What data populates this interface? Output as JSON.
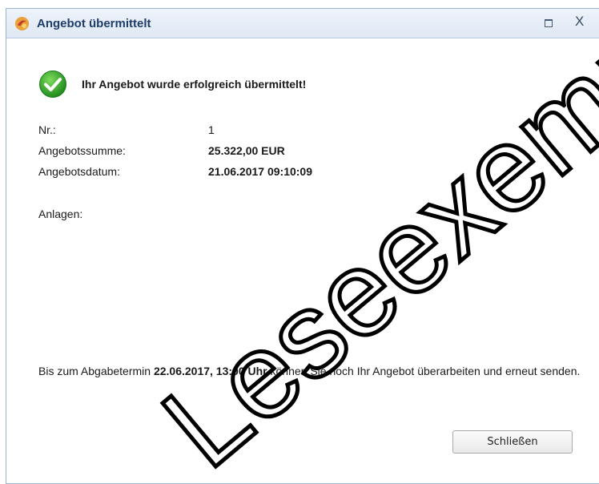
{
  "window": {
    "title": "Angebot übermittelt",
    "maximize_icon": "maximize-icon",
    "close_label": "X"
  },
  "message": {
    "success_text": "Ihr Angebot wurde erfolgreich übermittelt!",
    "icon": "check-circle-icon"
  },
  "details": {
    "nr_label": "Nr.:",
    "nr_value": "1",
    "sum_label": "Angebotssumme:",
    "sum_value": "25.322,00 EUR",
    "date_label": "Angebotsdatum:",
    "date_value": "21.06.2017 09:10:09",
    "attachments_label": "Anlagen:"
  },
  "deadline": {
    "prefix": "Bis zum Abgabetermin ",
    "date": "22.06.2017, 13:00 Uhr",
    "suffix": " können Sie noch Ihr Angebot überarbeiten und erneut senden."
  },
  "buttons": {
    "close": "Schließen"
  },
  "watermark": {
    "text": "Leseexemplar",
    "color": "#000000"
  },
  "colors": {
    "title_text": "#1e3d6b",
    "success_green": "#2fa52a"
  }
}
